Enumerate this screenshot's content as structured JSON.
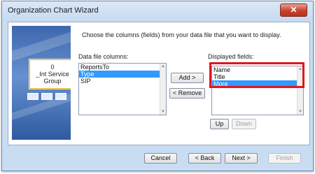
{
  "window": {
    "title": "Organization Chart Wizard",
    "close_glyph": "✕"
  },
  "sidebar": {
    "org_box_lines": [
      "0",
      "_Int Service",
      "Group"
    ]
  },
  "main": {
    "instruction": "Choose the columns (fields) from your data file that you want to display.",
    "data_file_columns_label": "Data file columns:",
    "data_file_columns": [
      {
        "label": "ReportsTo",
        "selected": false
      },
      {
        "label": "Type",
        "selected": true
      },
      {
        "label": "SIP",
        "selected": false
      }
    ],
    "displayed_fields_label": "Displayed fields:",
    "displayed_fields": [
      {
        "label": "Name",
        "selected": false
      },
      {
        "label": "Title",
        "selected": false
      },
      {
        "label": "More",
        "selected": true
      }
    ],
    "add_label": "Add >",
    "remove_label": "< Remove",
    "up_label": "Up",
    "down_label": "Down"
  },
  "footer": {
    "cancel_label": "Cancel",
    "back_label": "< Back",
    "next_label": "Next >",
    "finish_label": "Finish"
  },
  "colors": {
    "highlight": "#e0161e",
    "selection": "#3399ff"
  }
}
